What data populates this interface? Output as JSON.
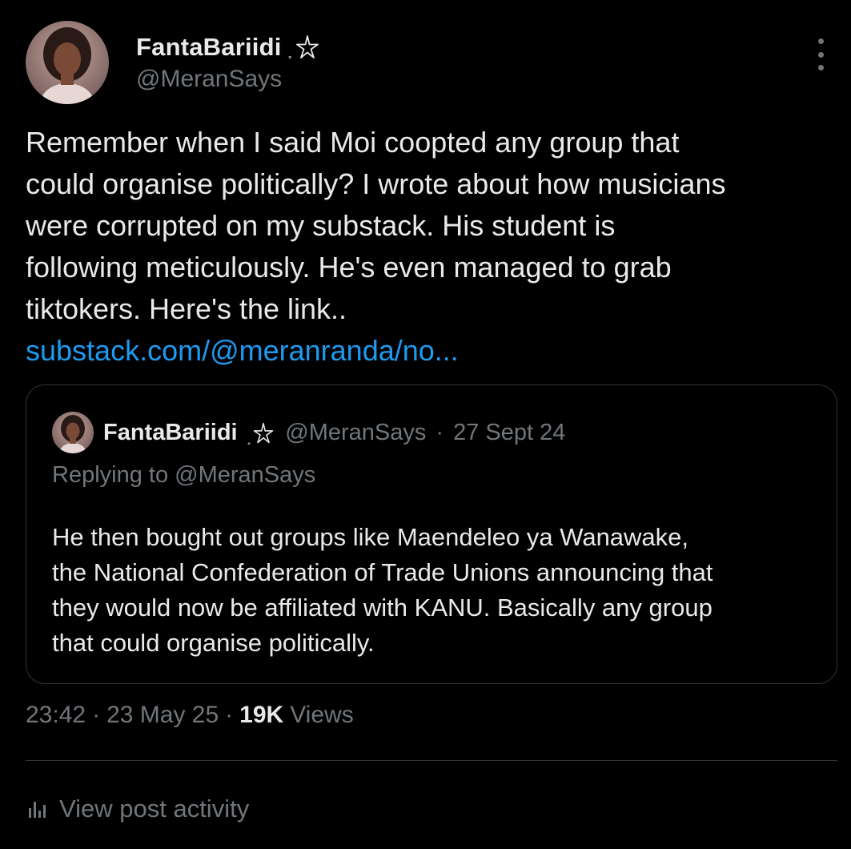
{
  "author": {
    "display_name": "FantaBariidi",
    "name_ring": "˳",
    "handle": "@MeranSays"
  },
  "post": {
    "text": "Remember when I said Moi coopted any group that\ncould organise politically? I wrote about how musicians\nwere corrupted on my substack. His student is\nfollowing meticulously. He's even managed to grab\ntiktokers. Here's the link..\n",
    "link_text": "substack.com/@meranranda/no..."
  },
  "quoted_post": {
    "display_name": "FantaBariidi",
    "name_ring": "˳",
    "handle": "@MeranSays",
    "separator": "·",
    "date": "27 Sept 24",
    "replying_to": "Replying to @MeranSays",
    "text": "He then bought out groups like Maendeleo ya Wanawake,\nthe National Confederation of Trade Unions announcing that\nthey would now be affiliated with KANU. Basically any group\nthat could organise politically."
  },
  "meta": {
    "time": "23:42",
    "separator": "·",
    "date": "23 May 25",
    "views_count": "19K",
    "views_label": "Views"
  },
  "activity": {
    "label": "View post activity",
    "icon": "bar-chart-icon"
  },
  "icons": {
    "more": "more-vertical-icon",
    "star": "star-outline-icon"
  },
  "colors": {
    "background": "#000000",
    "text_primary": "#e7e9ea",
    "text_secondary": "#71767b",
    "link": "#1d9bf0",
    "border": "#2f3336"
  }
}
